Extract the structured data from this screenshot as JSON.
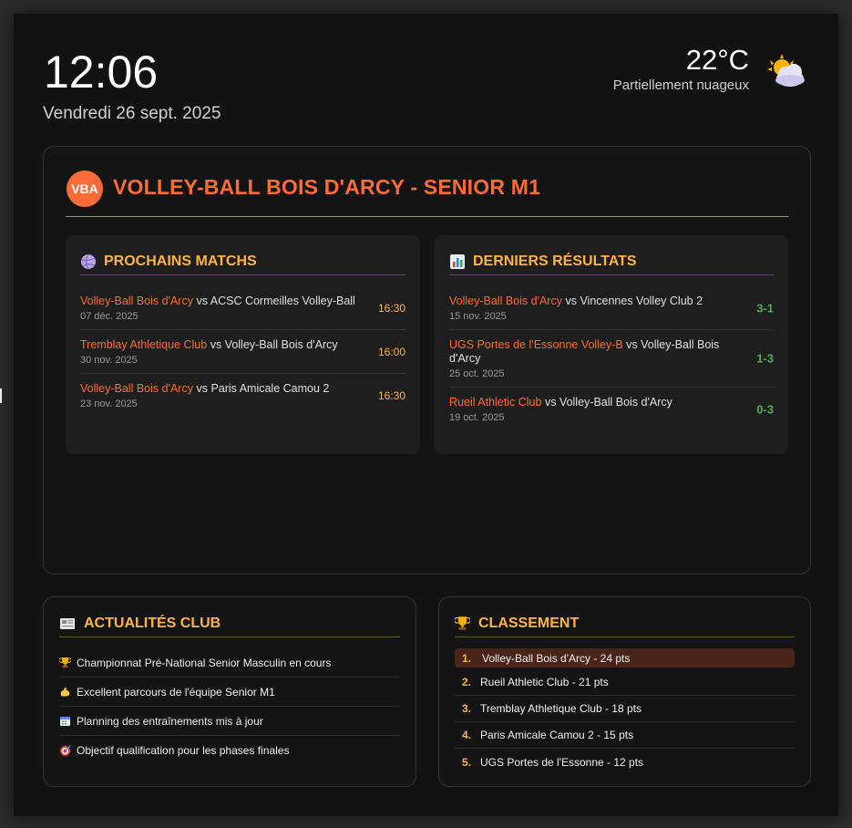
{
  "clock": {
    "time": "12:06",
    "date": "Vendredi 26 sept. 2025"
  },
  "weather": {
    "temp": "22°C",
    "description": "Partiellement nuageux",
    "icon": "partly-cloudy-icon"
  },
  "club": {
    "logo": "VBA",
    "title": "VOLLEY-BALL BOIS D'ARCY - SENIOR M1",
    "accent": "#ff6b35",
    "heading_color": "#ffb347"
  },
  "upcoming": {
    "title": "PROCHAINS MATCHS",
    "icon": "volleyball-icon",
    "matches": [
      {
        "home": "Volley-Ball Bois d'Arcy",
        "vs": "vs",
        "away": "ACSC Cormeilles Volley-Ball",
        "date": "07 déc. 2025",
        "time": "16:30"
      },
      {
        "home": "Tremblay Athletique Club",
        "vs": "vs",
        "away": "Volley-Ball Bois d'Arcy",
        "date": "30 nov. 2025",
        "time": "16:00"
      },
      {
        "home": "Volley-Ball Bois d'Arcy",
        "vs": "vs",
        "away": "Paris Amicale Camou 2",
        "date": "23 nov. 2025",
        "time": "16:30"
      }
    ]
  },
  "results": {
    "title": "DERNIERS RÉSULTATS",
    "icon": "bar-chart-icon",
    "matches": [
      {
        "home": "Volley-Ball Bois d'Arcy",
        "vs": "vs",
        "away": "Vincennes Volley Club 2",
        "date": "15 nov. 2025",
        "score": "3-1"
      },
      {
        "home": "UGS Portes de l'Essonne Volley-B",
        "vs": "vs",
        "away": "Volley-Ball Bois d'Arcy",
        "date": "25 oct. 2025",
        "score": "1-3"
      },
      {
        "home": "Rueil Athletic Club",
        "vs": "vs",
        "away": "Volley-Ball Bois d'Arcy",
        "date": "19 oct. 2025",
        "score": "0-3"
      }
    ]
  },
  "news": {
    "title": "ACTUALITÉS CLUB",
    "icon": "newspaper-icon",
    "items": [
      {
        "icon": "trophy-icon",
        "text": "Championnat Pré-National Senior Masculin en cours"
      },
      {
        "icon": "flexed-biceps-icon",
        "text": "Excellent parcours de l'équipe Senior M1"
      },
      {
        "icon": "calendar-icon",
        "text": "Planning des entraînements mis à jour"
      },
      {
        "icon": "target-icon",
        "text": "Objectif qualification pour les phases finales"
      }
    ]
  },
  "ranking": {
    "title": "CLASSEMENT",
    "icon": "trophy-icon",
    "items": [
      {
        "pos": "1.",
        "text": "Volley-Ball Bois d'Arcy - 24 pts"
      },
      {
        "pos": "2.",
        "text": "Rueil Athletic Club - 21 pts"
      },
      {
        "pos": "3.",
        "text": "Tremblay Athletique Club - 18 pts"
      },
      {
        "pos": "4.",
        "text": "Paris Amicale Camou 2 - 15 pts"
      },
      {
        "pos": "5.",
        "text": "UGS Portes de l'Essonne - 12 pts"
      }
    ]
  }
}
